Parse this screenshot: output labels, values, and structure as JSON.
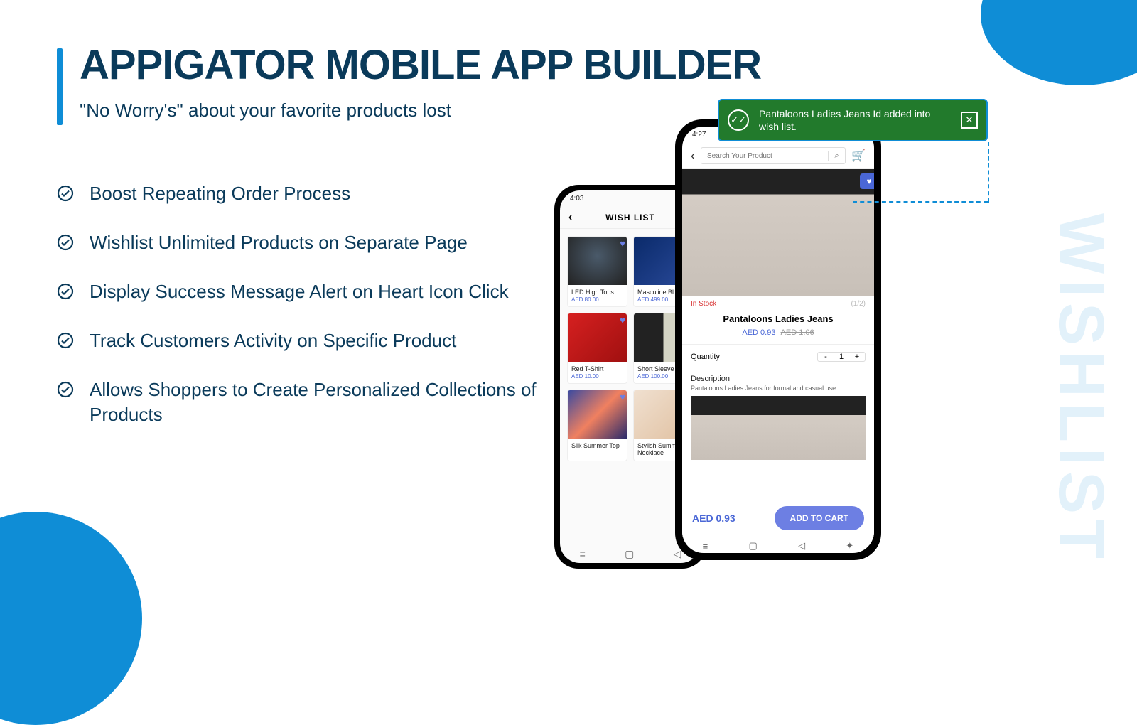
{
  "title": "APPIGATOR MOBILE APP BUILDER",
  "subtitle": "\"No Worry's\" about your favorite products lost",
  "features": [
    "Boost Repeating Order Process",
    "Wishlist Unlimited Products on Separate Page",
    "Display Success Message Alert on Heart Icon Click",
    "Track Customers Activity on Specific Product",
    "Allows Shoppers to Create Personalized Collections of Products"
  ],
  "vertical_label": "WISHLIST",
  "toast": {
    "message": "Pantaloons Ladies Jeans Id added into wish list."
  },
  "phone_wishlist": {
    "time": "4:03",
    "header": "WISH LIST",
    "products": [
      {
        "name": "LED High Tops",
        "price": "AED 80.00"
      },
      {
        "name": "Masculine Bl...",
        "price": "AED 499.00"
      },
      {
        "name": "Red T-Shirt",
        "price": "AED 10.00"
      },
      {
        "name": "Short Sleeve Shirt",
        "price": "AED 100.00"
      },
      {
        "name": "Silk Summer Top",
        "price": ""
      },
      {
        "name": "Stylish Summer Necklace",
        "price": ""
      }
    ]
  },
  "phone_product": {
    "time": "4:27",
    "search_placeholder": "Search Your Product",
    "stock_status": "In Stock",
    "img_count": "(1/2)",
    "name": "Pantaloons Ladies Jeans",
    "price": "AED 0.93",
    "old_price": "AED 1.06",
    "qty_label": "Quantity",
    "qty_value": "1",
    "desc_heading": "Description",
    "desc_text": "Pantaloons Ladies Jeans for formal and casual use",
    "bottom_price": "AED 0.93",
    "add_to_cart": "ADD TO CART"
  }
}
